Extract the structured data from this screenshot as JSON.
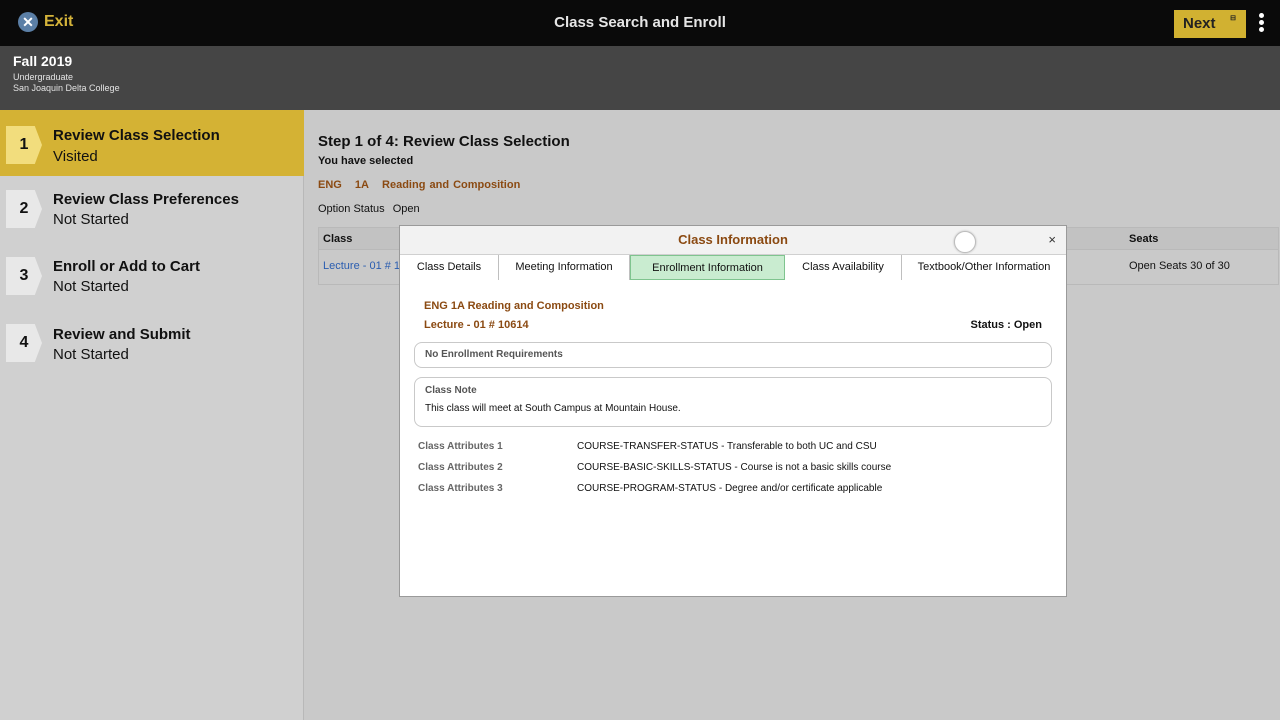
{
  "topbar": {
    "exit_label": "Exit",
    "exit_glyph": "✕",
    "title": "Class Search and Enroll",
    "next_label": "Next",
    "next_mini": "⊟"
  },
  "term": {
    "name": "Fall 2019",
    "career": "Undergraduate",
    "institution": "San Joaquin Delta College"
  },
  "steps": [
    {
      "number": "1",
      "title": "Review Class Selection",
      "status": "Visited",
      "active": true
    },
    {
      "number": "2",
      "title": "Review Class Preferences",
      "status": "Not Started",
      "active": false
    },
    {
      "number": "3",
      "title": "Enroll or Add to Cart",
      "status": "Not Started",
      "active": false
    },
    {
      "number": "4",
      "title": "Review and Submit",
      "status": "Not Started",
      "active": false
    }
  ],
  "main": {
    "heading": "Step 1 of 4: Review Class Selection",
    "you_selected": "You have selected",
    "course": {
      "subject": "ENG",
      "catalog": "1A",
      "title": "Reading and Composition"
    },
    "option_status_label": "Option Status",
    "option_status_value": "Open",
    "table": {
      "headers": {
        "class": "Class",
        "seats": "Seats"
      },
      "row": {
        "class": "Lecture - 01 # 10614",
        "seats": "Open Seats 30 of 30"
      }
    }
  },
  "modal": {
    "title": "Class Information",
    "close_glyph": "×",
    "tabs": [
      "Class Details",
      "Meeting Information",
      "Enrollment Information",
      "Class Availability",
      "Textbook/Other Information"
    ],
    "active_tab": 2,
    "course_title": "ENG 1A Reading and Composition",
    "section": "Lecture - 01 # 10614",
    "status": "Status : Open",
    "requirements": "No Enrollment Requirements",
    "class_note_label": "Class Note",
    "class_note_text": "This class will meet at South Campus at Mountain House.",
    "attributes": [
      {
        "label": "Class Attributes 1",
        "value": "COURSE-TRANSFER-STATUS - Transferable to both UC and CSU"
      },
      {
        "label": "Class Attributes 2",
        "value": "COURSE-BASIC-SKILLS-STATUS - Course is not a basic skills course"
      },
      {
        "label": "Class Attributes 3",
        "value": "COURSE-PROGRAM-STATUS - Degree and/or certificate applicable"
      }
    ]
  }
}
